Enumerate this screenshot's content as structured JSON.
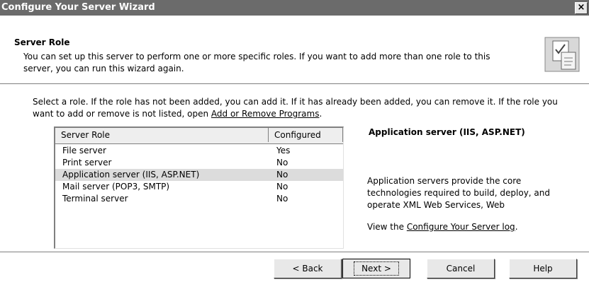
{
  "window": {
    "title": "Configure Your Server Wizard",
    "close_glyph": "×"
  },
  "header": {
    "title": "Server Role",
    "description": "You can set up this server to perform one or more specific roles. If you want to add more than one role to this server, you can run this wizard again."
  },
  "intro": {
    "text_before_link": "Select a role. If the role has not been added, you can add it. If it has already been added, you can remove it. If the role you want to add or remove is not listed, open ",
    "link": "Add or Remove Programs",
    "text_after_link": "."
  },
  "list": {
    "columns": [
      "Server Role",
      "Configured"
    ],
    "rows": [
      {
        "role": "File server",
        "configured": "Yes"
      },
      {
        "role": "Print server",
        "configured": "No"
      },
      {
        "role": "Application server (IIS, ASP.NET)",
        "configured": "No",
        "selected": true
      },
      {
        "role": "Mail server (POP3, SMTP)",
        "configured": "No"
      },
      {
        "role": "Terminal server",
        "configured": "No"
      }
    ]
  },
  "details": {
    "title": "Application server (IIS, ASP.NET)",
    "description": "Application servers provide the core technologies required to build, deploy, and operate XML Web Services, Web",
    "log_prefix": "View the ",
    "log_link": "Configure Your Server log",
    "log_suffix": "."
  },
  "buttons": {
    "back": "< Back",
    "next": "Next >",
    "cancel": "Cancel",
    "help": "Help"
  },
  "icons": {
    "wizard": "checklist-icon",
    "close": "close-icon"
  }
}
